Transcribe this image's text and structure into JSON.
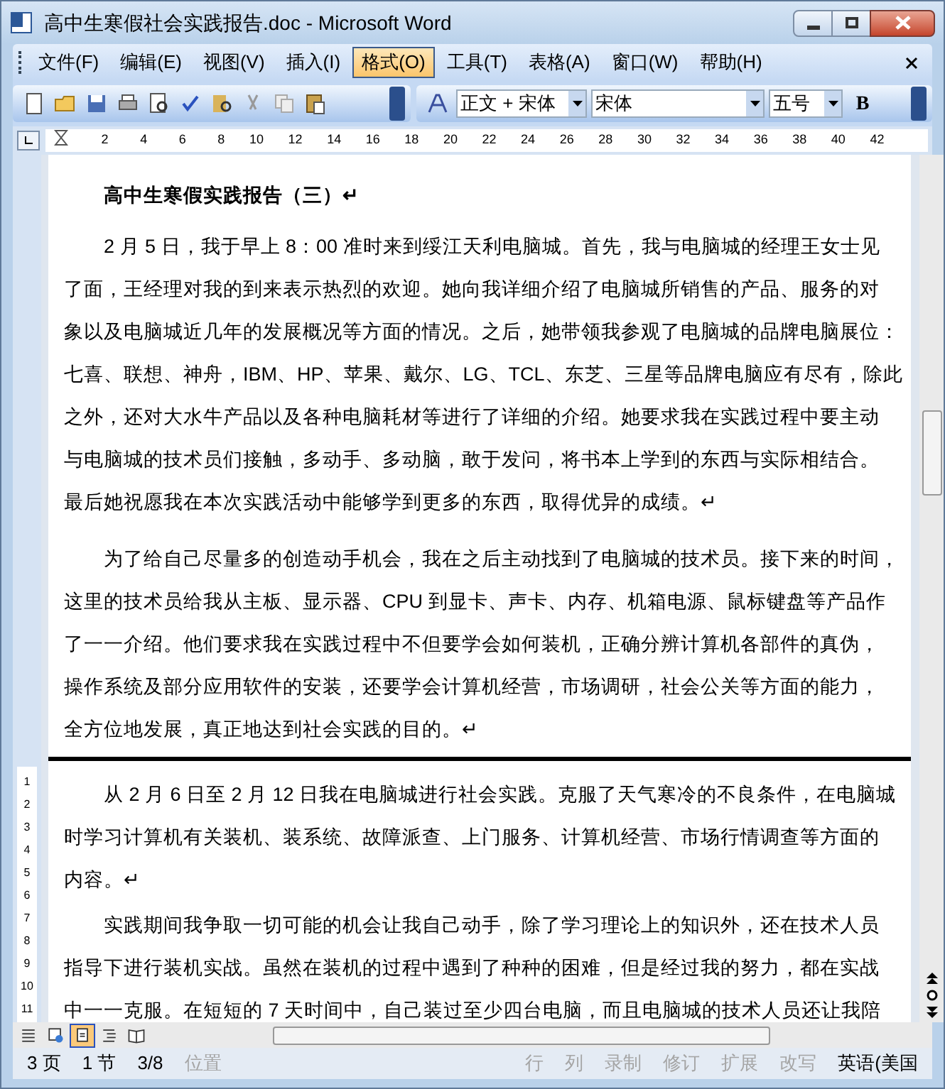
{
  "window": {
    "title": "高中生寒假社会实践报告.doc - Microsoft Word"
  },
  "menu": [
    {
      "label": "文件(F)",
      "selected": false
    },
    {
      "label": "编辑(E)",
      "selected": false
    },
    {
      "label": "视图(V)",
      "selected": false
    },
    {
      "label": "插入(I)",
      "selected": false
    },
    {
      "label": "格式(O)",
      "selected": true
    },
    {
      "label": "工具(T)",
      "selected": false
    },
    {
      "label": "表格(A)",
      "selected": false
    },
    {
      "label": "窗口(W)",
      "selected": false
    },
    {
      "label": "帮助(H)",
      "selected": false
    }
  ],
  "formatting": {
    "style": "正文 + 宋体",
    "font": "宋体",
    "size": "五号",
    "bold": "B"
  },
  "ruler": [
    "2",
    "4",
    "6",
    "8",
    "10",
    "12",
    "14",
    "16",
    "18",
    "20",
    "22",
    "24",
    "26",
    "28",
    "30",
    "32",
    "34",
    "36",
    "38",
    "40",
    "42"
  ],
  "vertical_ruler": [
    "1",
    "2",
    "3",
    "4",
    "5",
    "6",
    "7",
    "8",
    "9",
    "10",
    "11"
  ],
  "pages": [
    {
      "heading": "高中生寒假实践报告（三）↵",
      "paragraphs": [
        [
          "2 月 5 日，我于早上 8：00 准时来到绥江天利电脑城。首先，我与电脑城的经理王女士见",
          "了面，王经理对我的到来表示热烈的欢迎。她向我详细介绍了电脑城所销售的产品、服务的对",
          "象以及电脑城近几年的发展概况等方面的情况。之后，她带领我参观了电脑城的品牌电脑展位：",
          "七喜、联想、神舟，IBM、HP、苹果、戴尔、LG、TCL、东芝、三星等品牌电脑应有尽有，除此",
          "之外，还对大水牛产品以及各种电脑耗材等进行了详细的介绍。她要求我在实践过程中要主动",
          "与电脑城的技术员们接触，多动手、多动脑，敢于发问，将书本上学到的东西与实际相结合。",
          "最后她祝愿我在本次实践活动中能够学到更多的东西，取得优异的成绩。↵"
        ],
        [
          "为了给自己尽量多的创造动手机会，我在之后主动找到了电脑城的技术员。接下来的时间，",
          "这里的技术员给我从主板、显示器、CPU 到显卡、声卡、内存、机箱电源、鼠标键盘等产品作",
          "了一一介绍。他们要求我在实践过程中不但要学会如何装机，正确分辨计算机各部件的真伪，",
          "操作系统及部分应用软件的安装，还要学会计算机经营，市场调研，社会公关等方面的能力，",
          "全方位地发展，真正地达到社会实践的目的。↵"
        ]
      ]
    },
    {
      "paragraphs": [
        [
          "从 2 月 6 日至 2 月 12 日我在电脑城进行社会实践。克服了天气寒冷的不良条件，在电脑城",
          "时学习计算机有关装机、装系统、故障派查、上门服务、计算机经营、市场行情调查等方面的",
          "内容。↵"
        ],
        [
          "实践期间我争取一切可能的机会让我自己动手，除了学习理论上的知识外，还在技术人员",
          "指导下进行装机实战。虽然在装机的过程中遇到了种种的困难，但是经过我的努力，都在实战",
          "中一一克服。在短短的 7 天时间中，自己装过至少四台电脑，而且电脑城的技术人员还让我陪"
        ]
      ]
    }
  ],
  "view_buttons": [
    {
      "kind": "normal",
      "selected": false
    },
    {
      "kind": "web",
      "selected": false
    },
    {
      "kind": "print",
      "selected": true
    },
    {
      "kind": "outline",
      "selected": false
    },
    {
      "kind": "reading",
      "selected": false
    }
  ],
  "status_bar": [
    {
      "label": "3 页",
      "disabled": false
    },
    {
      "label": "1 节",
      "disabled": false
    },
    {
      "label": "3/8",
      "disabled": false
    },
    {
      "label": "位置",
      "disabled": true
    },
    {
      "label": "行",
      "disabled": true
    },
    {
      "label": "列",
      "disabled": true
    },
    {
      "label": "录制",
      "disabled": true
    },
    {
      "label": "修订",
      "disabled": true
    },
    {
      "label": "扩展",
      "disabled": true
    },
    {
      "label": "改写",
      "disabled": true
    },
    {
      "label": "英语(美国",
      "disabled": false
    }
  ]
}
